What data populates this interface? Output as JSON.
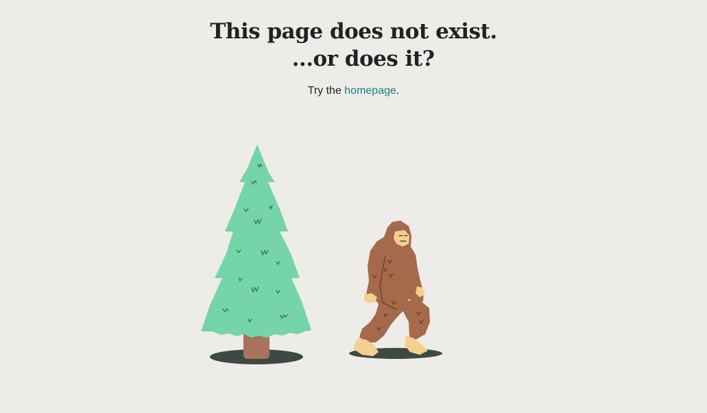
{
  "heading": {
    "line1": "This page does not exist.",
    "line2": "...or does it?"
  },
  "message": {
    "prefix": "Try the ",
    "link_text": "homepage",
    "suffix": "."
  },
  "colors": {
    "background": "#eeece8",
    "text": "#222222",
    "link": "#1b7c83",
    "tree_foliage": "#75d5a8",
    "tree_trunk": "#a8725b",
    "bigfoot_fur": "#a5694b",
    "bigfoot_skin": "#f4cf8e",
    "shadow": "#3d4a44"
  },
  "illustration": {
    "tree": "pine-tree-illustration",
    "creature": "bigfoot-illustration"
  }
}
